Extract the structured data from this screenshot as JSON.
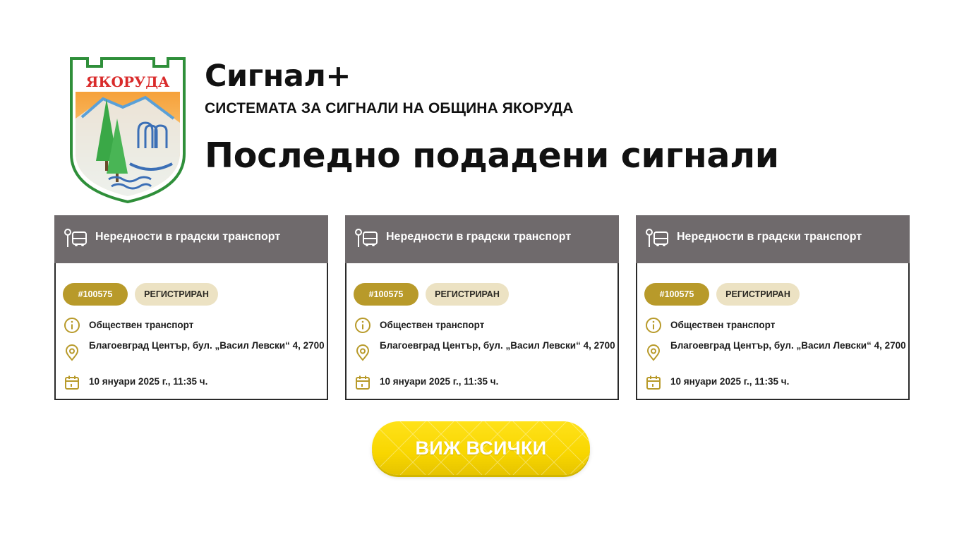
{
  "logo": {
    "text": "ЯКОРУДА"
  },
  "header": {
    "app_title": "Сигнал+",
    "app_subtitle": "СИСТЕМАТА ЗА СИГНАЛИ НА ОБЩИНА ЯКОРУДА",
    "section_title": "Последно подадени сигнали"
  },
  "cards": [
    {
      "category": "Нередности в градски транспорт",
      "id": "#100575",
      "status": "РЕГИСТРИРАН",
      "type": "Обществен транспорт",
      "address": "Благоевград Център, бул. „Васил Левски“ 4, 2700",
      "date": "10 януари 2025 г., 11:35 ч."
    },
    {
      "category": "Нередности в градски транспорт",
      "id": "#100575",
      "status": "РЕГИСТРИРАН",
      "type": "Обществен транспорт",
      "address": "Благоевград Център, бул. „Васил Левски“ 4, 2700",
      "date": "10 януари 2025 г., 11:35 ч."
    },
    {
      "category": "Нередности в градски транспорт",
      "id": "#100575",
      "status": "РЕГИСТРИРАН",
      "type": "Обществен транспорт",
      "address": "Благоевград Център, бул. „Васил Левски“ 4, 2700",
      "date": "10 януари 2025 г., 11:35 ч."
    }
  ],
  "cta": {
    "label": "ВИЖ ВСИЧКИ"
  },
  "icons": {
    "category": "bus-stop-icon",
    "type": "info-icon",
    "address": "location-pin-icon",
    "date": "calendar-icon"
  },
  "colors": {
    "card_header": "#6f6a6c",
    "badge_id": "#b89a2a",
    "badge_status": "#ece2c3",
    "cta": "#f8d600",
    "icon_gold": "#b89a2a"
  }
}
